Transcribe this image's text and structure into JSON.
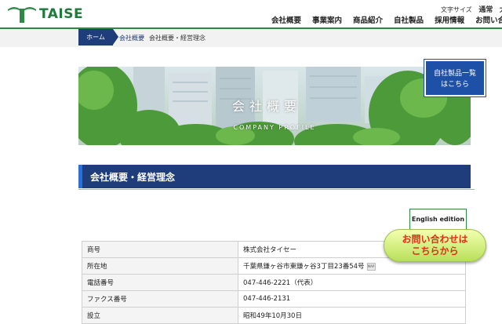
{
  "header": {
    "logo_text": "TAISE",
    "font_size_label": "文字サイズ",
    "font_size_options": [
      "通常",
      "大"
    ],
    "nav": [
      "会社概要",
      "事業案内",
      "商品紹介",
      "自社製品",
      "採用情報",
      "お問い合"
    ]
  },
  "breadcrumb": {
    "home": "ホーム",
    "level1": "会社概要",
    "separator": "›",
    "current": "会社概要・経営理念"
  },
  "hero": {
    "title": "会社概要",
    "subtitle": "COMPANY PROFILE"
  },
  "own_products_button": {
    "line1": "自社製品一覧",
    "line2": "はこちら"
  },
  "section_heading": "会社概要・経営理念",
  "english_button": "English edition",
  "contact_button": {
    "line1": "お問い合わせは",
    "line2": "こちらから"
  },
  "company_table": [
    {
      "label": "商号",
      "value": "株式会社タイセー"
    },
    {
      "label": "所在地",
      "value": "千葉県鎌ヶ谷市東鎌ヶ谷3丁目23番54号"
    },
    {
      "label": "電話番号",
      "value": "047-446-2221（代表）"
    },
    {
      "label": "ファクス番号",
      "value": "047-446-2131"
    },
    {
      "label": "設立",
      "value": "昭和49年10月30日"
    }
  ],
  "map_icon_label": "MAP",
  "colors": {
    "brand_green": "#2d8a46",
    "navy": "#1e3d7a",
    "button_blue": "#1e50a8",
    "contact_text": "#e0301a"
  }
}
